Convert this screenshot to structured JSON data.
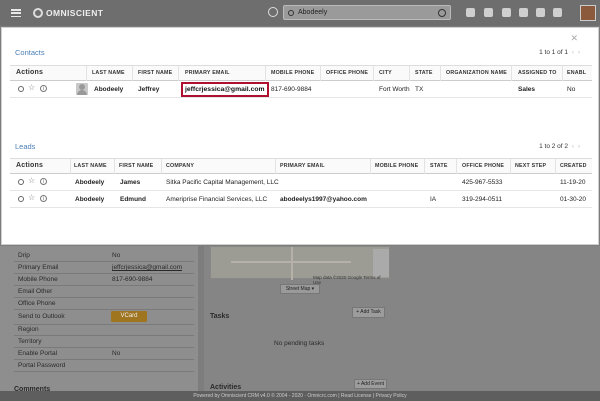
{
  "topbar": {
    "brand": "OMNISCIENT",
    "search_value": "Abodeely"
  },
  "contacts": {
    "title": "Contacts",
    "pager": "1 to 1 of 1",
    "columns": [
      "Actions",
      "LAST NAME",
      "FIRST NAME",
      "PRIMARY EMAIL",
      "MOBILE PHONE",
      "OFFICE PHONE",
      "CITY",
      "STATE",
      "ORGANIZATION NAME",
      "ASSIGNED TO",
      "ENABL"
    ],
    "rows": [
      {
        "last": "Abodeely",
        "first": "Jeffrey",
        "email": "jeffcrjessica@gmail.com",
        "mobile": "817-690-9884",
        "office": "",
        "city": "Fort Worth",
        "state": "TX",
        "org": "",
        "assigned": "Sales",
        "enabled": "No"
      }
    ]
  },
  "leads": {
    "title": "Leads",
    "pager": "1 to 2 of 2",
    "columns": [
      "Actions",
      "LAST NAME",
      "FIRST NAME",
      "COMPANY",
      "PRIMARY EMAIL",
      "MOBILE PHONE",
      "STATE",
      "OFFICE PHONE",
      "NEXT STEP",
      "CREATED"
    ],
    "rows": [
      {
        "last": "Abodeely",
        "first": "James",
        "company": "Sitka Pacific Capital Management, LLC",
        "email": "",
        "mobile": "",
        "state": "",
        "office": "425-967-5533",
        "next": "",
        "created": "11-19-20"
      },
      {
        "last": "Abodeely",
        "first": "Edmund",
        "company": "Ameriprise Financial Services, LLC",
        "email": "abodeelys1997@yahoo.com",
        "mobile": "",
        "state": "IA",
        "office": "319-294-0511",
        "next": "",
        "created": "01-30-20"
      }
    ]
  },
  "background": {
    "fields": [
      {
        "label": "Drip",
        "value": "No"
      },
      {
        "label": "Primary Email",
        "value": "jeffcrjessica@gmail.com"
      },
      {
        "label": "Mobile Phone",
        "value": "817-690-9884"
      },
      {
        "label": "Email Other",
        "value": ""
      },
      {
        "label": "Office Phone",
        "value": ""
      },
      {
        "label": "Send to Outlook",
        "value": ""
      },
      {
        "label": "Region",
        "value": ""
      },
      {
        "label": "Territory",
        "value": ""
      },
      {
        "label": "Enable Portal",
        "value": "No"
      },
      {
        "label": "Portal Password",
        "value": ""
      }
    ],
    "vcard": "VCard",
    "comments": "Comments",
    "map_attribution": "Map data ©2020 Google   Terms of Use",
    "map_type": "Street Map ▾",
    "tasks_title": "Tasks",
    "add_task": "+ Add Task",
    "no_tasks": "No pending tasks",
    "activities_title": "Activities",
    "add_event": "+ Add Event"
  },
  "footer": "Powered by Omniscient CRM v4.0 © 2004 - 2020 · Omnicrc.com | Read License | Privacy Policy"
}
